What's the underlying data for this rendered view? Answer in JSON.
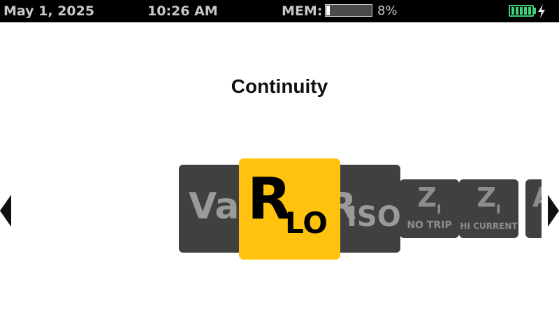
{
  "status": {
    "date": "May 1, 2025",
    "time": "10:26 AM",
    "mem_label": "MEM:",
    "mem_percent_text": "8%",
    "mem_fraction": 0.08,
    "battery_level": 1.0,
    "battery_color": "#3fd07a",
    "charging_icon": "lightning-bolt-icon"
  },
  "title": "Continuity",
  "modes": [
    {
      "id": "vac",
      "main": "Va"
    },
    {
      "id": "rlo",
      "main": "R",
      "sub": "LO",
      "selected": true
    },
    {
      "id": "riso",
      "main": "R",
      "sub": "ISO"
    },
    {
      "id": "zi-no-trip",
      "main": "Z",
      "sub": "I",
      "label": "NO TRIP"
    },
    {
      "id": "zi-hi-current",
      "main": "Z",
      "sub": "I",
      "label": "HI CURRENT"
    },
    {
      "id": "next",
      "main": "A"
    }
  ],
  "colors": {
    "selected": "#ffc20e",
    "card": "#404040",
    "status_bar": "#000000"
  },
  "icons": {
    "left": "triangle-left-icon",
    "right": "triangle-right-icon"
  }
}
